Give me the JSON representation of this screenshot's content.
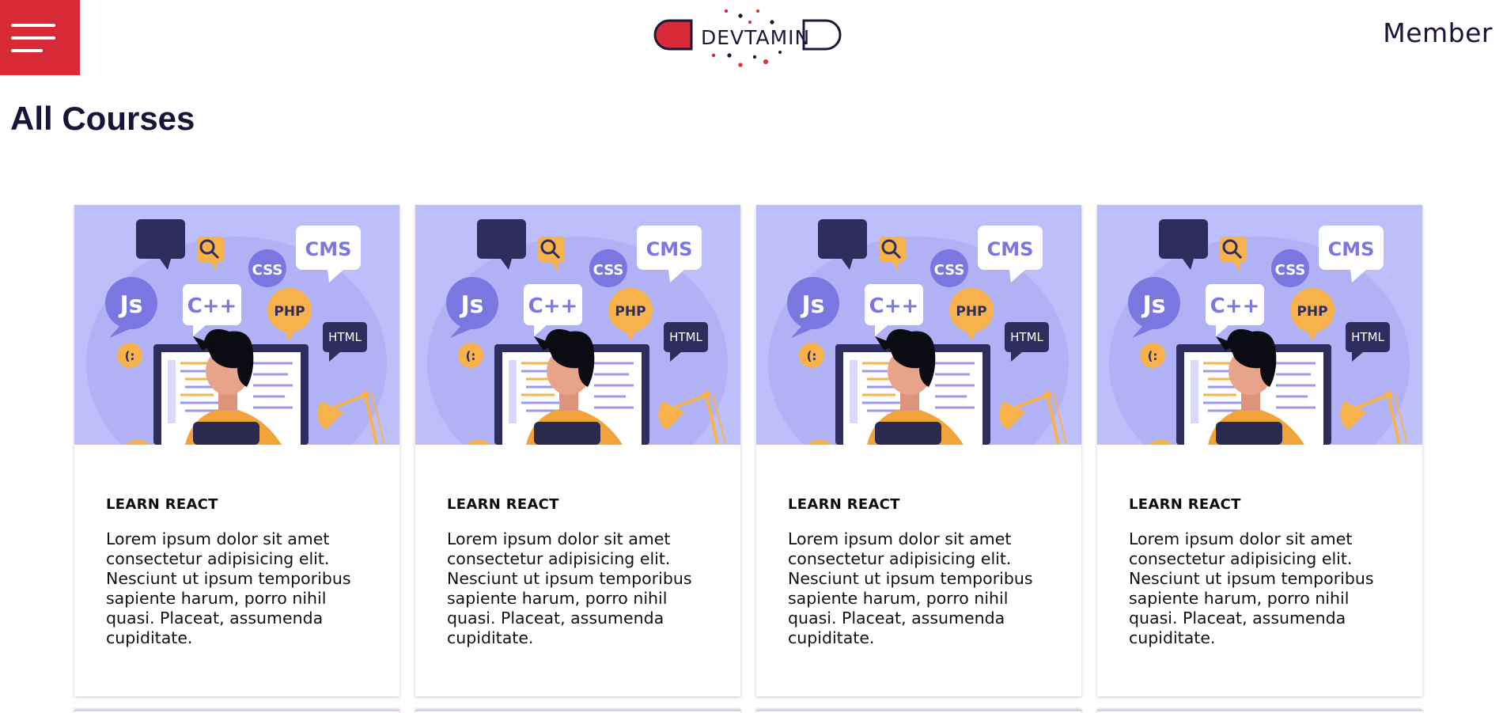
{
  "header": {
    "menu_icon": "hamburger-menu-icon",
    "logo_text": "DEVTAMIN",
    "member_label": "Member",
    "brand_red": "#d92b37",
    "brand_navy": "#1b1a3a"
  },
  "main": {
    "title": "All Courses",
    "courses": [
      {
        "title": "LEARN REACT",
        "description": "Lorem ipsum dolor sit amet consectetur adipisicing elit. Nesciunt ut ipsum temporibus sapiente harum, porro nihil quasi. Placeat, assumenda cupiditate.",
        "image": "developer-at-computer-illustration",
        "image_bubbles": [
          "</>",
          "CMS",
          "CSS",
          "Js",
          "C++",
          "PHP",
          "HTML",
          "(:"
        ]
      },
      {
        "title": "LEARN REACT",
        "description": "Lorem ipsum dolor sit amet consectetur adipisicing elit. Nesciunt ut ipsum temporibus sapiente harum, porro nihil quasi. Placeat, assumenda cupiditate.",
        "image": "developer-at-computer-illustration",
        "image_bubbles": [
          "</>",
          "CMS",
          "CSS",
          "Js",
          "C++",
          "PHP",
          "HTML",
          "(:"
        ]
      },
      {
        "title": "LEARN REACT",
        "description": "Lorem ipsum dolor sit amet consectetur adipisicing elit. Nesciunt ut ipsum temporibus sapiente harum, porro nihil quasi. Placeat, assumenda cupiditate.",
        "image": "developer-at-computer-illustration",
        "image_bubbles": [
          "</>",
          "CMS",
          "CSS",
          "Js",
          "C++",
          "PHP",
          "HTML",
          "(:"
        ]
      },
      {
        "title": "LEARN REACT",
        "description": "Lorem ipsum dolor sit amet consectetur adipisicing elit. Nesciunt ut ipsum temporibus sapiente harum, porro nihil quasi. Placeat, assumenda cupiditate.",
        "image": "developer-at-computer-illustration",
        "image_bubbles": [
          "</>",
          "CMS",
          "CSS",
          "Js",
          "C++",
          "PHP",
          "HTML",
          "(:"
        ]
      }
    ]
  }
}
